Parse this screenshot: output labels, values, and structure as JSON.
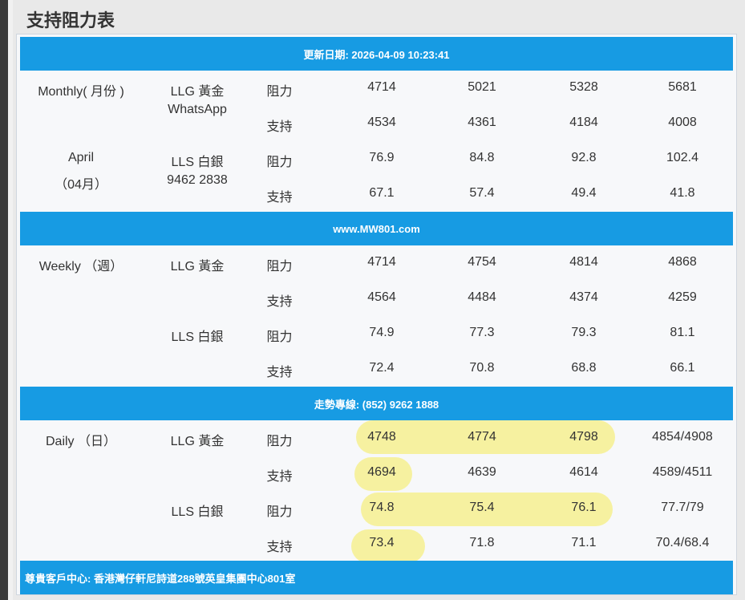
{
  "page_title": "支持阻力表",
  "banners": {
    "update": "更新日期: 2026-04-09 10:23:41",
    "website": "www.MW801.com",
    "hotline": "走勢專線: (852) 9262 1888",
    "address": "尊貴客戶中心: 香港灣仔軒尼詩道288號英皇集團中心801室"
  },
  "monthly": {
    "period": "Monthly( 月份 )",
    "period_sub1": "April",
    "period_sub2": "（04月）",
    "llg": "LLG 黃金",
    "llg_sub": "WhatsApp",
    "lls": "LLS 白銀",
    "lls_sub": "9462 2838",
    "resist": "阻力",
    "support": "支持",
    "llg_resist": [
      "4714",
      "5021",
      "5328",
      "5681"
    ],
    "llg_support": [
      "4534",
      "4361",
      "4184",
      "4008"
    ],
    "lls_resist": [
      "76.9",
      "84.8",
      "92.8",
      "102.4"
    ],
    "lls_support": [
      "67.1",
      "57.4",
      "49.4",
      "41.8"
    ]
  },
  "weekly": {
    "period": "Weekly （週）",
    "llg": "LLG 黃金",
    "lls": "LLS 白銀",
    "resist": "阻力",
    "support": "支持",
    "llg_resist": [
      "4714",
      "4754",
      "4814",
      "4868"
    ],
    "llg_support": [
      "4564",
      "4484",
      "4374",
      "4259"
    ],
    "lls_resist": [
      "74.9",
      "77.3",
      "79.3",
      "81.1"
    ],
    "lls_support": [
      "72.4",
      "70.8",
      "68.8",
      "66.1"
    ]
  },
  "daily": {
    "period": "Daily （日）",
    "llg": "LLG 黃金",
    "lls": "LLS 白銀",
    "resist": "阻力",
    "support": "支持",
    "llg_resist": [
      "4748",
      "4774",
      "4798",
      "4854/4908"
    ],
    "llg_support": [
      "4694",
      "4639",
      "4614",
      "4589/4511"
    ],
    "lls_resist": [
      "74.8",
      "75.4",
      "76.1",
      "77.7/79"
    ],
    "lls_support": [
      "73.4",
      "71.8",
      "71.1",
      "70.4/68.4"
    ]
  },
  "colors": {
    "banner": "#179be3",
    "highlight": "#f6f08f",
    "text": "#333333"
  }
}
